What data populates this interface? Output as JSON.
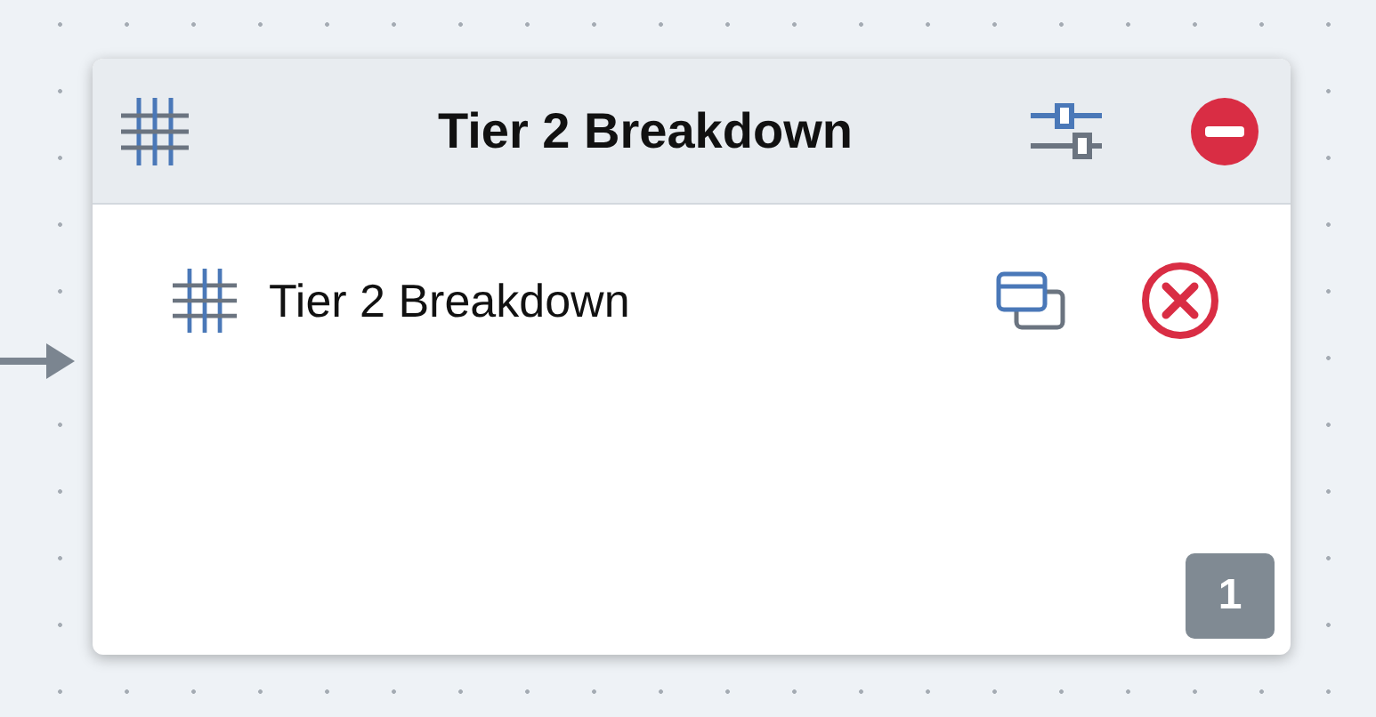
{
  "node": {
    "title": "Tier 2 Breakdown",
    "items": [
      {
        "label": "Tier 2 Breakdown"
      }
    ],
    "badge": "1"
  }
}
